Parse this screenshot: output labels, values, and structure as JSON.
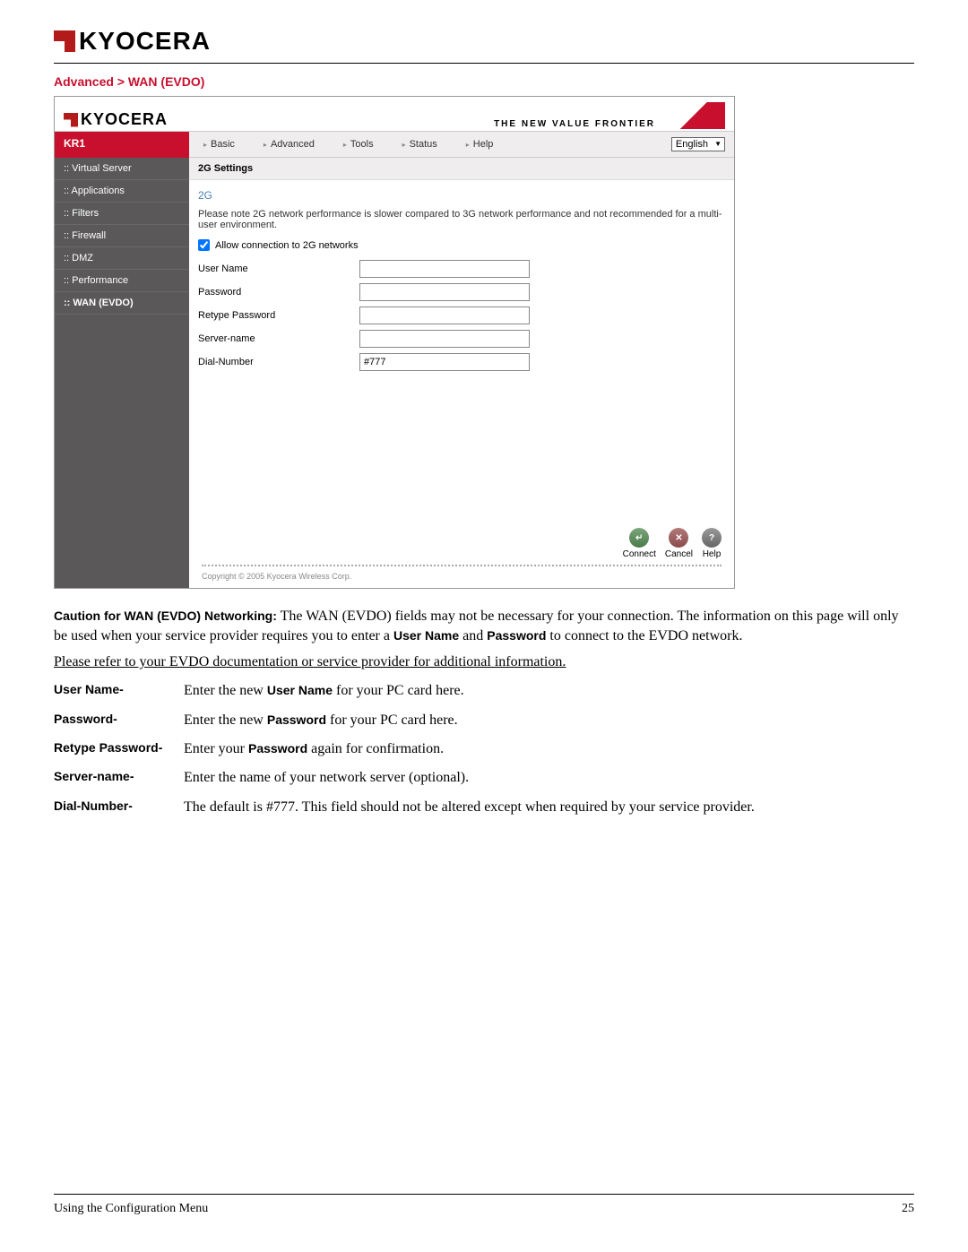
{
  "page": {
    "logo_text": "KYOCERA",
    "breadcrumb": "Advanced > WAN (EVDO)",
    "footer_text": "Using the Configuration Menu",
    "page_number": "25"
  },
  "screenshot": {
    "logo_text": "KYOCERA",
    "tagline": "THE NEW VALUE FRONTIER",
    "model": "KR1",
    "tabs": [
      "Basic",
      "Advanced",
      "Tools",
      "Status",
      "Help"
    ],
    "language": "English",
    "sidebar": [
      ":: Virtual Server",
      ":: Applications",
      ":: Filters",
      ":: Firewall",
      ":: DMZ",
      ":: Performance",
      ":: WAN (EVDO)"
    ],
    "section_head": "2G Settings",
    "section_title": "2G",
    "note": "Please note 2G network performance is slower compared to 3G network performance and not recommended for a multi-user environment.",
    "allow_label": "Allow connection to 2G networks",
    "allow_checked": true,
    "fields": {
      "username_label": "User Name",
      "username_value": "",
      "password_label": "Password",
      "password_value": "",
      "retype_label": "Retype Password",
      "retype_value": "",
      "server_label": "Server-name",
      "server_value": "",
      "dial_label": "Dial-Number",
      "dial_value": "#777"
    },
    "buttons": {
      "connect": "Connect",
      "cancel": "Cancel",
      "help": "Help"
    },
    "copyright": "Copyright © 2005 Kyocera Wireless Corp."
  },
  "doc": {
    "caution_bold": "Caution for WAN (EVDO) Networking:",
    "caution_text_1": " The WAN (EVDO) fields may not be necessary for your connection. The information on this page will only be used when your service provider requires you to enter a ",
    "caution_user": "User Name",
    "caution_and": " and ",
    "caution_pass": "Password",
    "caution_text_2": " to connect to the EVDO network.",
    "refer": "Please refer to your EVDO documentation or service provider for additional information.",
    "defs": [
      {
        "term": "User Name-",
        "pre": "Enter the new ",
        "bold": "User Name",
        "post": " for your PC card here."
      },
      {
        "term": "Password-",
        "pre": "Enter the new ",
        "bold": "Password",
        "post": " for your PC card here."
      },
      {
        "term": "Retype Password-",
        "pre": "Enter your ",
        "bold": "Password",
        "post": " again for confirmation."
      },
      {
        "term": "Server-name-",
        "pre": "Enter the name of your network server (optional).",
        "bold": "",
        "post": ""
      },
      {
        "term": "Dial-Number-",
        "pre": "The default is #777. This field should not be altered except when required by your service provider.",
        "bold": "",
        "post": ""
      }
    ]
  }
}
